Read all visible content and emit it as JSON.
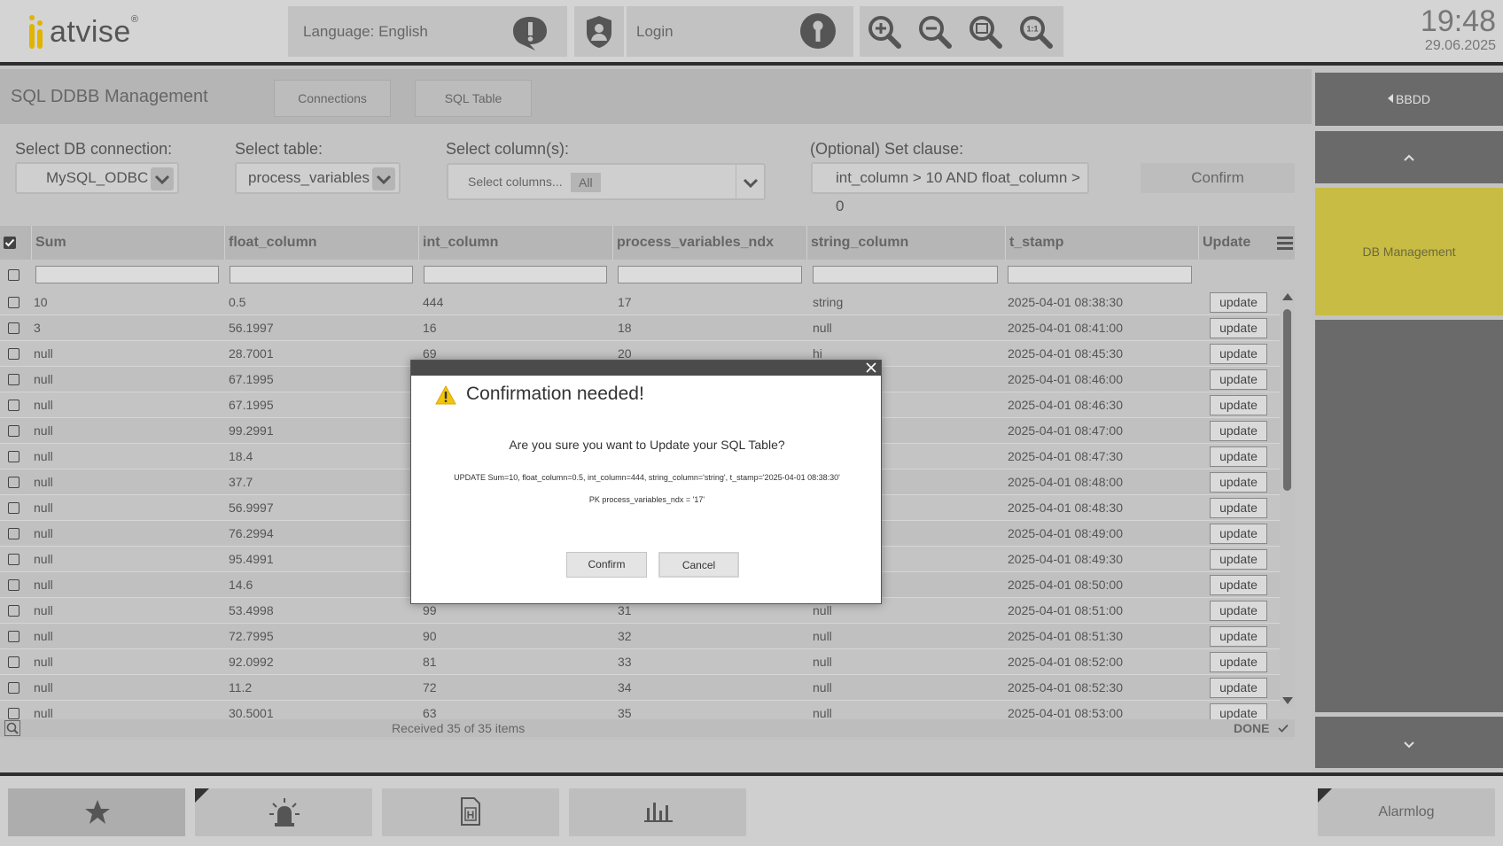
{
  "header": {
    "logo_text": "atvise",
    "logo_reg": "®",
    "language_label": "Language: English",
    "login_label": "Login",
    "time": "19:48",
    "date": "29.06.2025"
  },
  "page": {
    "title": "SQL DDBB Management",
    "tabs": [
      {
        "label": "Connections"
      },
      {
        "label": "SQL Table"
      }
    ]
  },
  "config": {
    "db_connection_label": "Select DB connection:",
    "db_connection_value": "MySQL_ODBC",
    "table_label": "Select table:",
    "table_value": "process_variables",
    "columns_label": "Select column(s):",
    "columns_placeholder": "Select columns...",
    "columns_tag": "All",
    "set_clause_label": "(Optional) Set clause:",
    "set_clause_value": "int_column > 10 AND float_column > 0",
    "confirm_label": "Confirm"
  },
  "table": {
    "columns": [
      "Sum",
      "float_column",
      "int_column",
      "process_variables_ndx",
      "string_column",
      "t_stamp",
      "Update"
    ],
    "update_label": "update",
    "rows": [
      [
        "10",
        "0.5",
        "444",
        "17",
        "string",
        "2025-04-01 08:38:30"
      ],
      [
        "3",
        "56.1997",
        "16",
        "18",
        "null",
        "2025-04-01 08:41:00"
      ],
      [
        "null",
        "28.7001",
        "69",
        "20",
        "hi",
        "2025-04-01 08:45:30"
      ],
      [
        "null",
        "67.1995",
        "",
        "",
        "",
        "2025-04-01 08:46:00"
      ],
      [
        "null",
        "67.1995",
        "",
        "",
        "",
        "2025-04-01 08:46:30"
      ],
      [
        "null",
        "99.2991",
        "",
        "",
        "",
        "2025-04-01 08:47:00"
      ],
      [
        "null",
        "18.4",
        "",
        "",
        "",
        "2025-04-01 08:47:30"
      ],
      [
        "null",
        "37.7",
        "",
        "",
        "",
        "2025-04-01 08:48:00"
      ],
      [
        "null",
        "56.9997",
        "",
        "",
        "",
        "2025-04-01 08:48:30"
      ],
      [
        "null",
        "76.2994",
        "",
        "",
        "",
        "2025-04-01 08:49:00"
      ],
      [
        "null",
        "95.4991",
        "",
        "",
        "",
        "2025-04-01 08:49:30"
      ],
      [
        "null",
        "14.6",
        "",
        "",
        "",
        "2025-04-01 08:50:00"
      ],
      [
        "null",
        "53.4998",
        "99",
        "31",
        "null",
        "2025-04-01 08:51:00"
      ],
      [
        "null",
        "72.7995",
        "90",
        "32",
        "null",
        "2025-04-01 08:51:30"
      ],
      [
        "null",
        "92.0992",
        "81",
        "33",
        "null",
        "2025-04-01 08:52:00"
      ],
      [
        "null",
        "11.2",
        "72",
        "34",
        "null",
        "2025-04-01 08:52:30"
      ],
      [
        "null",
        "30.5001",
        "63",
        "35",
        "null",
        "2025-04-01 08:53:00"
      ]
    ],
    "status": "Received 35 of 35 items",
    "done": "DONE"
  },
  "sidebar": {
    "back_label": "BBDD",
    "active_label": "DB Management"
  },
  "footer": {
    "alarmlog_label": "Alarmlog"
  },
  "modal": {
    "title": "Confirmation needed!",
    "question": "Are you sure you want to Update your SQL Table?",
    "sql": "UPDATE Sum=10, float_column=0.5, int_column=444, string_column='string', t_stamp='2025-04-01 08:38:30'",
    "pk": "PK process_variables_ndx = '17'",
    "confirm_label": "Confirm",
    "cancel_label": "Cancel"
  },
  "colors": {
    "accent_yellow": "#c9bc45",
    "logo_yellow": "#e0b400",
    "sidebar_gray": "#6a6a6a",
    "header_border": "#2e2e2e"
  }
}
